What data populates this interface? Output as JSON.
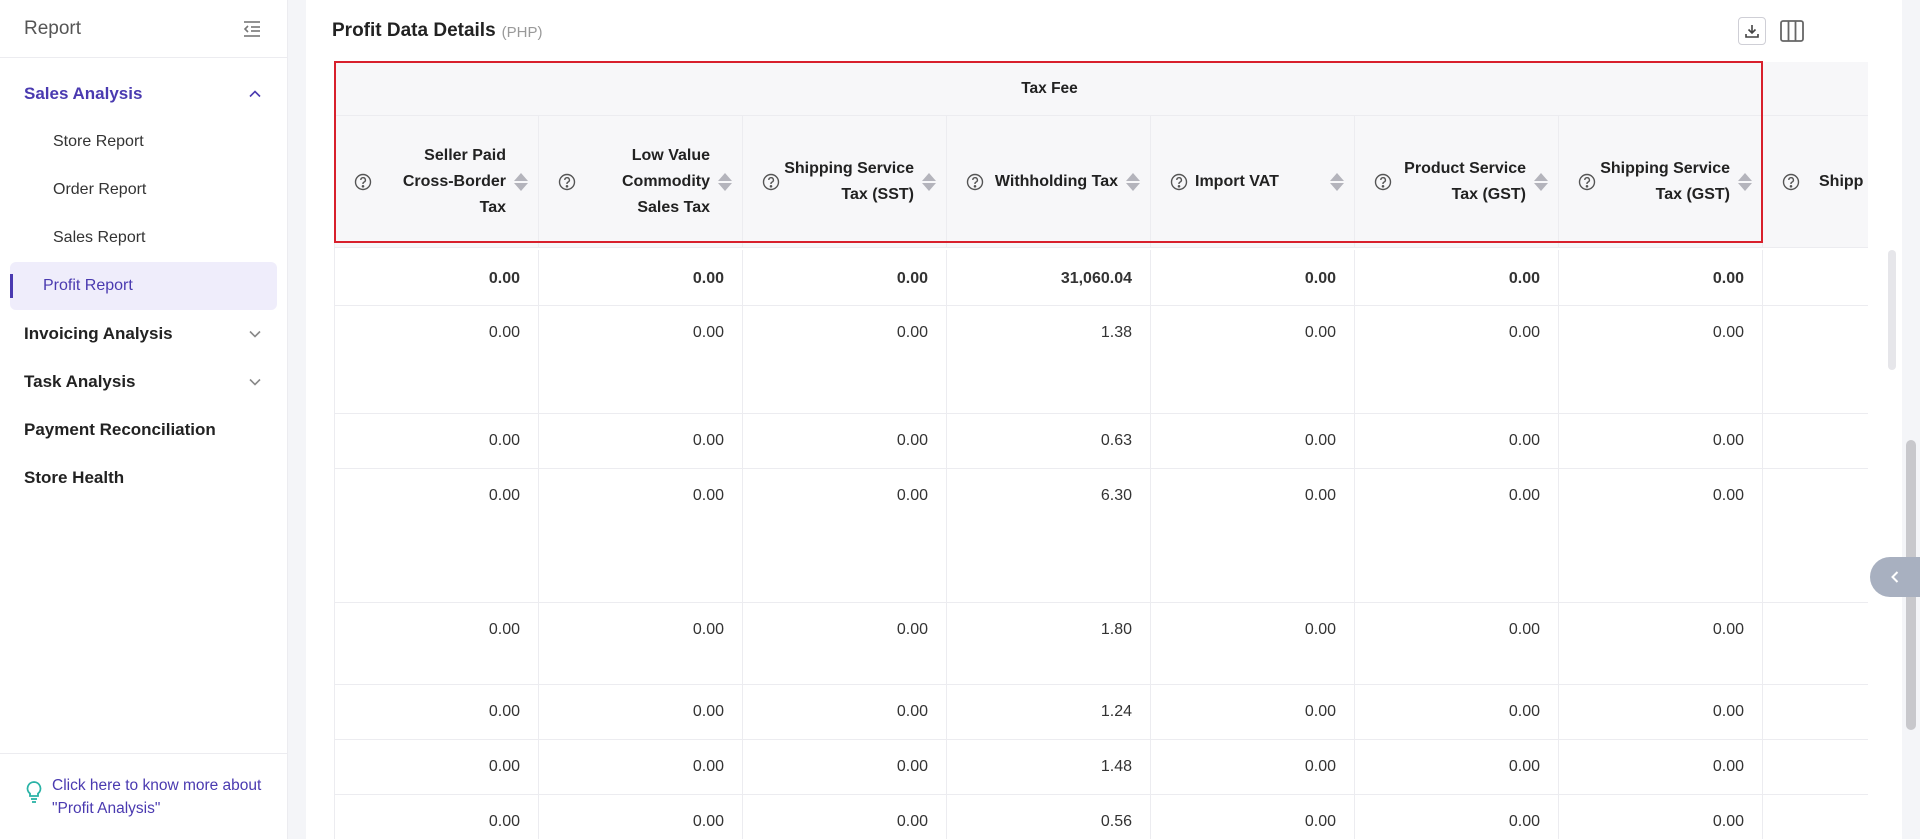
{
  "sidebar": {
    "title": "Report",
    "groups": [
      {
        "label": "Sales Analysis",
        "active": true
      },
      {
        "label": "Invoicing Analysis"
      },
      {
        "label": "Task Analysis"
      }
    ],
    "sub_items": [
      "Store Report",
      "Order Report",
      "Sales Report",
      "Profit Report"
    ],
    "standalone": [
      "Payment Reconciliation",
      "Store Health"
    ],
    "footer_help": "Click here to know more about \"Profit Analysis\"",
    "accent": "#4a3ab0"
  },
  "main": {
    "title": "Profit Data Details",
    "currency": "(PHP)",
    "table": {
      "group_header": "Tax Fee",
      "columns": [
        "Seller Paid Cross-Border Tax",
        "Low Value Commodity Sales Tax",
        "Shipping Service Tax (SST)",
        "Withholding Tax",
        "Import VAT",
        "Product Service Tax (GST)",
        "Shipping Service Tax (GST)",
        "Shipp"
      ],
      "rows": [
        [
          "0.00",
          "0.00",
          "0.00",
          "31,060.04",
          "0.00",
          "0.00",
          "0.00"
        ],
        [
          "0.00",
          "0.00",
          "0.00",
          "1.38",
          "0.00",
          "0.00",
          "0.00"
        ],
        [
          "0.00",
          "0.00",
          "0.00",
          "0.63",
          "0.00",
          "0.00",
          "0.00"
        ],
        [
          "0.00",
          "0.00",
          "0.00",
          "6.30",
          "0.00",
          "0.00",
          "0.00"
        ],
        [
          "0.00",
          "0.00",
          "0.00",
          "1.80",
          "0.00",
          "0.00",
          "0.00"
        ],
        [
          "0.00",
          "0.00",
          "0.00",
          "1.24",
          "0.00",
          "0.00",
          "0.00"
        ],
        [
          "0.00",
          "0.00",
          "0.00",
          "1.48",
          "0.00",
          "0.00",
          "0.00"
        ],
        [
          "0.00",
          "0.00",
          "0.00",
          "0.56",
          "0.00",
          "0.00",
          "0.00"
        ]
      ],
      "highlight_color": "#d8202c"
    }
  }
}
